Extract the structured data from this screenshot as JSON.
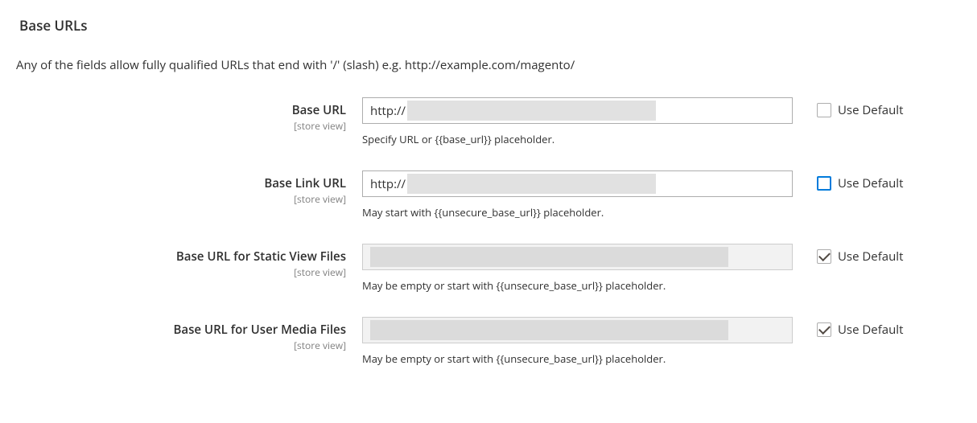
{
  "section": {
    "title": "Base URLs",
    "description": "Any of the fields allow fully qualified URLs that end with '/' (slash) e.g. http://example.com/magento/"
  },
  "fields": {
    "base_url": {
      "label": "Base URL",
      "scope": "[store view]",
      "value": "http://",
      "helper": "Specify URL or {{base_url}} placeholder.",
      "use_default_label": "Use Default",
      "use_default_checked": false
    },
    "base_link_url": {
      "label": "Base Link URL",
      "scope": "[store view]",
      "value": "http://",
      "helper": "May start with {{unsecure_base_url}} placeholder.",
      "use_default_label": "Use Default",
      "use_default_checked": false
    },
    "static_files_url": {
      "label": "Base URL for Static View Files",
      "scope": "[store view]",
      "value": "",
      "helper": "May be empty or start with {{unsecure_base_url}} placeholder.",
      "use_default_label": "Use Default",
      "use_default_checked": true
    },
    "media_files_url": {
      "label": "Base URL for User Media Files",
      "scope": "[store view]",
      "value": "",
      "helper": "May be empty or start with {{unsecure_base_url}} placeholder.",
      "use_default_label": "Use Default",
      "use_default_checked": true
    }
  }
}
